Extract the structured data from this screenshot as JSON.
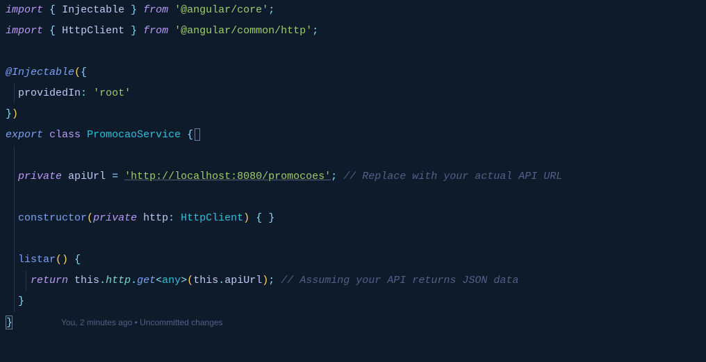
{
  "code": {
    "l1": {
      "import": "import",
      "lb": "{",
      "id": "Injectable",
      "rb": "}",
      "from": "from",
      "str": "'@angular/core'",
      "semi": ";"
    },
    "l2": {
      "import": "import",
      "lb": "{",
      "id": "HttpClient",
      "rb": "}",
      "from": "from",
      "str": "'@angular/common/http'",
      "semi": ";"
    },
    "l4a": {
      "dec": "@",
      "decName": "Injectable",
      "paren": "(",
      "brace": "{"
    },
    "l5": {
      "prop": "providedIn",
      "colon": ":",
      "str": "'root'"
    },
    "l6": {
      "brace": "}",
      "paren": ")"
    },
    "l7": {
      "export": "export",
      "class": "class",
      "name": "PromocaoService",
      "brace": "{"
    },
    "l9": {
      "priv": "private",
      "name": "apiUrl",
      "eq": "=",
      "str": "'http://localhost:8080/promocoes'",
      "semi": ";",
      "comment": "// Replace with your actual API URL"
    },
    "l11": {
      "ctor": "constructor",
      "lp": "(",
      "priv": "private",
      "name": "http",
      "colon": ":",
      "type": "HttpClient",
      "rp": ")",
      "lb": "{",
      "rb": "}"
    },
    "l13": {
      "name": "listar",
      "lp": "(",
      "rp": ")",
      "brace": "{"
    },
    "l14": {
      "ret": "return",
      "this": "this",
      "dot1": ".",
      "http": "http",
      "dot2": ".",
      "get": "get",
      "lt": "<",
      "any": "any",
      "gt": ">",
      "lp": "(",
      "this2": "this",
      "dot3": ".",
      "api": "apiUrl",
      "rp": ")",
      "semi": ";",
      "comment": "// Assuming your API returns JSON data"
    },
    "l15": {
      "brace": "}"
    },
    "l16": {
      "brace": "}"
    }
  },
  "codelens": {
    "text": "You, 2 minutes ago • Uncommitted changes"
  }
}
